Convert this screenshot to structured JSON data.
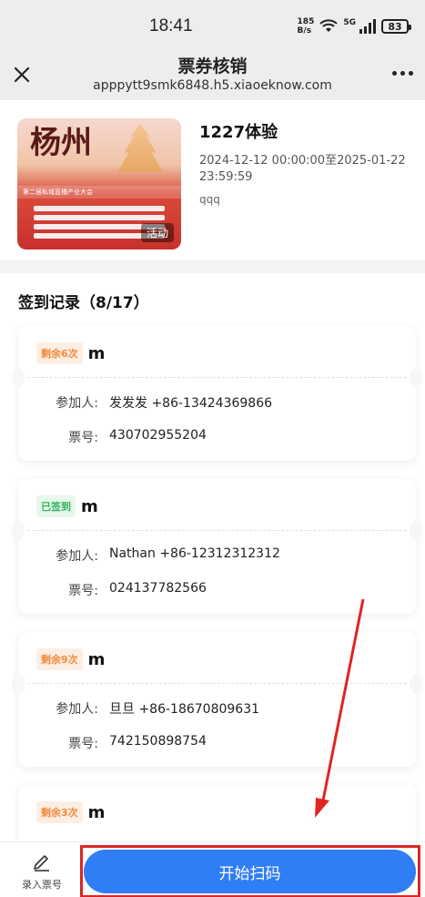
{
  "status_bar": {
    "time": "18:41",
    "speed_value": "185",
    "speed_unit": "B/s",
    "network": "5G",
    "battery": "83"
  },
  "nav": {
    "title": "票券核销",
    "url": "apppytt9smk6848.h5.xiaoeknow.com",
    "close_icon": "close-icon",
    "more_icon": "more-icon"
  },
  "event": {
    "name": "1227体验",
    "time": "2024-12-12 00:00:00至2025-01-22 23:59:59",
    "note": "qqq",
    "poster_tag": "活动",
    "poster_title": "杨州",
    "poster_band": "第二届私域直播产业大会"
  },
  "records": {
    "title": "签到记录（8/17）",
    "participant_label": "参加人:",
    "ticket_no_label": "票号:",
    "items": [
      {
        "badge": "剩余6次",
        "badge_type": "remain",
        "type": "m",
        "participant": "发发发 +86-13424369866",
        "ticket_no": "430702955204"
      },
      {
        "badge": "已签到",
        "badge_type": "checked",
        "type": "m",
        "participant": "Nathan +86-12312312312",
        "ticket_no": "024137782566"
      },
      {
        "badge": "剩余9次",
        "badge_type": "remain",
        "type": "m",
        "participant": "旦旦 +86-18670809631",
        "ticket_no": "742150898754"
      },
      {
        "badge": "剩余3次",
        "badge_type": "remain",
        "type": "m"
      }
    ]
  },
  "bottom": {
    "entry_label": "录入票号",
    "scan_label": "开始扫码"
  },
  "colors": {
    "primary": "#2f7ef5",
    "remain": "#f08a3c",
    "checked": "#2fb35a",
    "annotation": "#e02424"
  }
}
